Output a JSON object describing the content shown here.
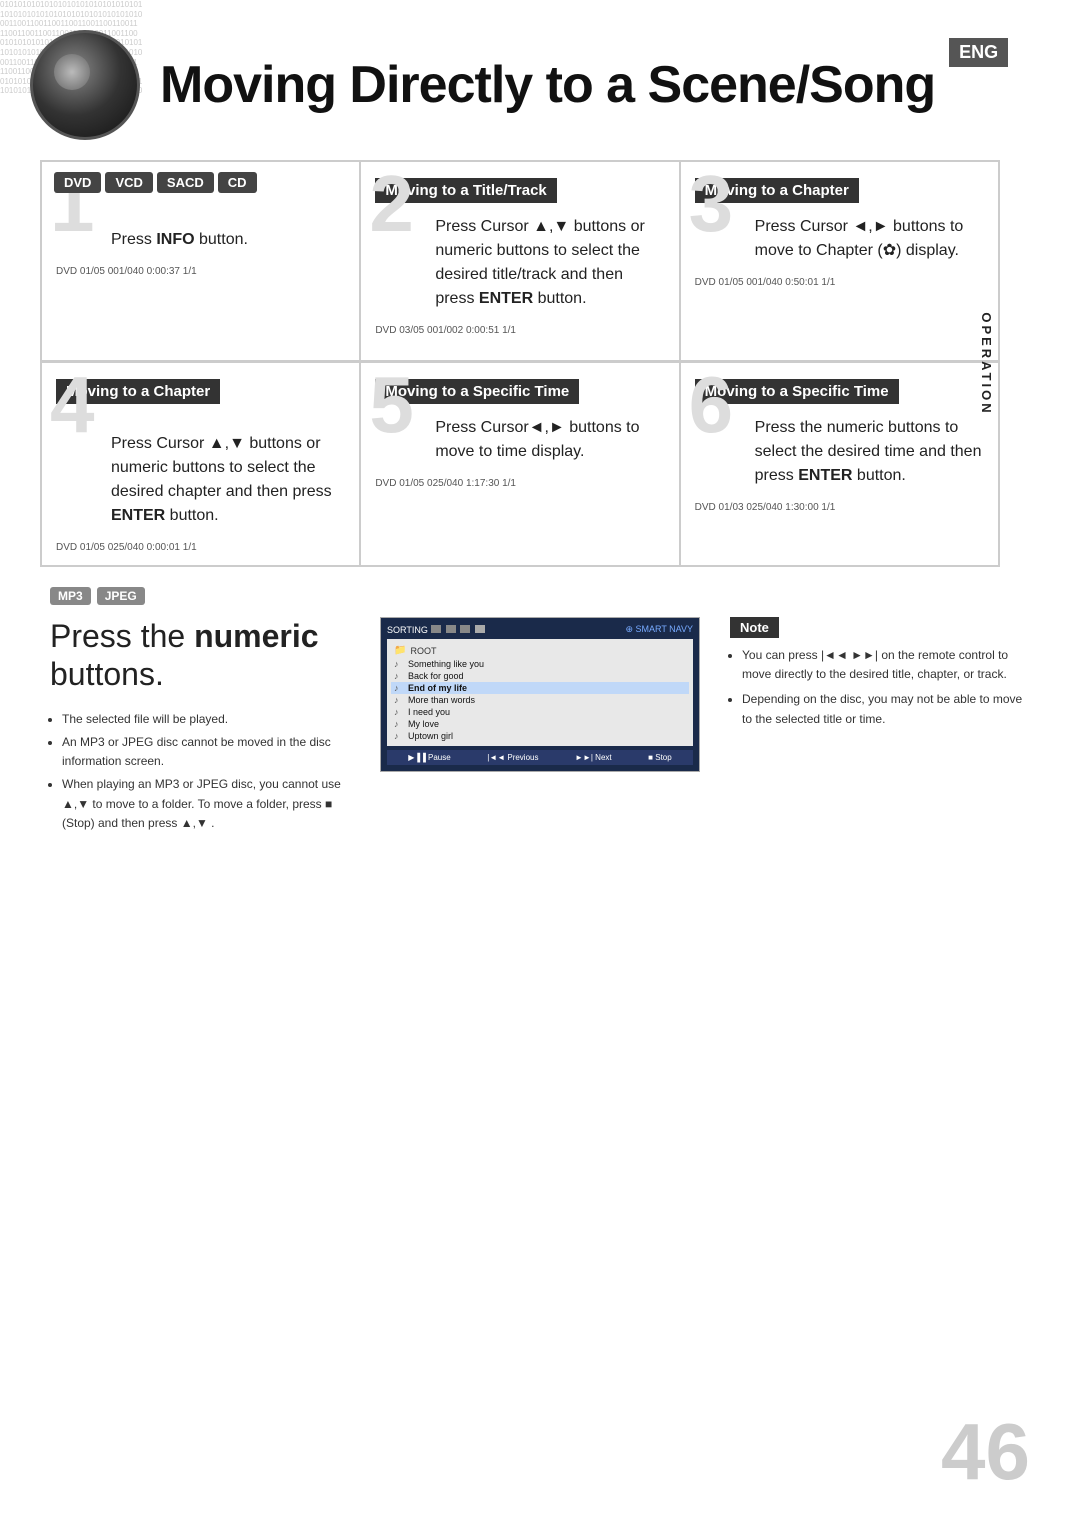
{
  "header": {
    "title": "Moving Directly to a Scene/Song",
    "eng_badge": "ENG",
    "binary_text": "0101010101010101010101010101\n1010101010101010101010101010\n0011001100110011001100110011\n1100110011001100110011001100\n0101010101010101010101010101\n1010101010101010101010101010\n0011001100110011001100110011\n1100110011001100110011001100\n0101010101010101010101010101"
  },
  "disc_badges": [
    "DVD",
    "VCD",
    "SACD",
    "CD"
  ],
  "step1": {
    "number": "1",
    "text_before": "Press ",
    "bold": "INFO",
    "text_after": " button.",
    "status": "DVD  01/05  001/040  0:00:37  1/1"
  },
  "section2_header": "Moving to a Title/Track",
  "step2": {
    "number": "2",
    "text": "Press Cursor ▲,▼ buttons or numeric buttons to select the desired title/track and then press ENTER button.",
    "status": "DVD  03/05  001/002  0:00:51  1/1"
  },
  "section3_header": "Moving to a Chapter",
  "step3": {
    "number": "3",
    "text": "Press Cursor ◄,► buttons to move to Chapter (✿) display.",
    "status": "DVD  01/05  001/040  0:50:01  1/1"
  },
  "section4_header": "Moving to a Chapter",
  "step4": {
    "number": "4",
    "text": "Press Cursor ▲,▼ buttons or numeric buttons to select the desired chapter and then press ENTER button.",
    "status": "DVD  01/05  025/040  0:00:01  1/1"
  },
  "section5_header": "Moving to a Specific Time",
  "step5": {
    "number": "5",
    "text": "Press Cursor◄,► buttons to move to time display.",
    "status": "DVD  01/05  025/040  1:17:30  1/1"
  },
  "section6_header": "Moving to a Specific Time",
  "step6": {
    "number": "6",
    "text": "Press the numeric buttons to select the desired time and then press ENTER button.",
    "status": "DVD  01/03  025/040  1:30:00  1/1"
  },
  "operation_label": "OPERATION",
  "mp3_badges": [
    "MP3",
    "JPEG"
  ],
  "mp3_title_before": "Press the ",
  "mp3_title_bold": "numeric",
  "mp3_title_after": " buttons.",
  "mp3_bullets": [
    "The selected file will be played.",
    "An MP3 or JPEG disc cannot be moved in the disc information screen.",
    "When playing an MP3 or JPEG disc, you cannot use ▲,▼ to move to a folder. To move a folder, press ■ (Stop) and then press ▲,▼ ."
  ],
  "screen": {
    "sorting_label": "SORTING",
    "smart_navy": "⊕ SMART NAVY",
    "root": "ROOT",
    "items": [
      {
        "num": "",
        "name": "Something like you",
        "selected": false
      },
      {
        "num": "",
        "name": "Back for good",
        "selected": false
      },
      {
        "num": "",
        "name": "End of my life",
        "selected": true
      },
      {
        "num": "",
        "name": "More than words",
        "selected": false
      },
      {
        "num": "",
        "name": "I need you",
        "selected": false
      },
      {
        "num": "",
        "name": "My love",
        "selected": false
      },
      {
        "num": "",
        "name": "Uptown girl",
        "selected": false
      }
    ],
    "footer_buttons": [
      "Pause",
      "Previous",
      "Next",
      "Stop"
    ]
  },
  "note_header": "Note",
  "note_bullets": [
    "You can press |◄◄ ►►| on the remote control to move directly to the desired title, chapter, or track.",
    "Depending on the disc, you may not be able to move to the selected title or time."
  ],
  "page_number": "46"
}
